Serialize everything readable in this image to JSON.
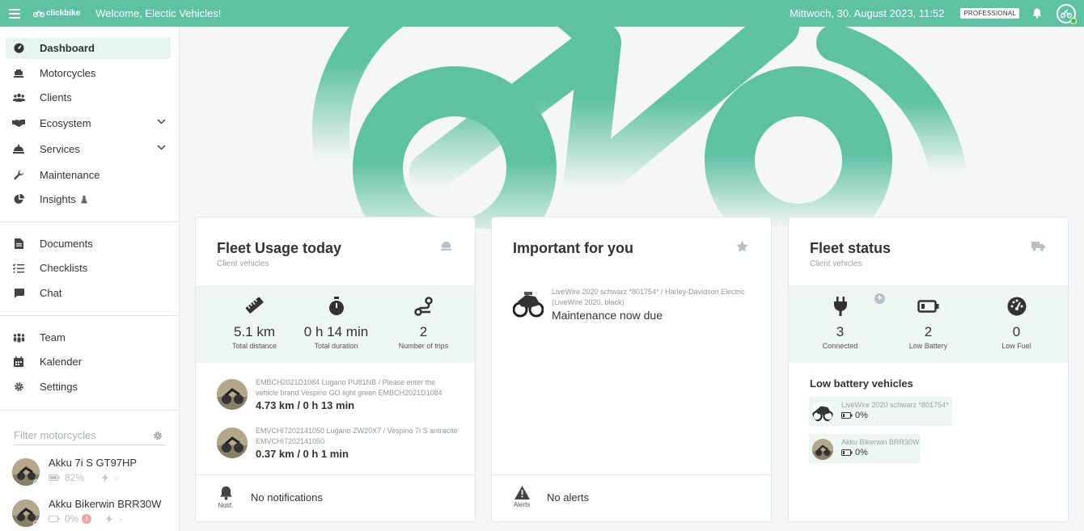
{
  "topbar": {
    "brand": "clickbike",
    "welcome": "Welcome, Electic Vehicles!",
    "datetime": "Mittwoch, 30. August 2023, 11:52",
    "plan": "PROFESSIONAL"
  },
  "sidebar": {
    "groups": [
      [
        {
          "label": "Dashboard",
          "icon": "gauge-icon",
          "active": true
        },
        {
          "label": "Motorcycles",
          "icon": "scooter-icon"
        },
        {
          "label": "Clients",
          "icon": "users-icon"
        },
        {
          "label": "Ecosystem",
          "icon": "handshake-icon",
          "expandable": true
        },
        {
          "label": "Services",
          "icon": "service-bell-icon",
          "expandable": true
        },
        {
          "label": "Maintenance",
          "icon": "wrench-icon"
        },
        {
          "label": "Insights",
          "icon": "pie-chart-icon",
          "beta": true
        }
      ],
      [
        {
          "label": "Documents",
          "icon": "document-icon"
        },
        {
          "label": "Checklists",
          "icon": "checklist-icon"
        },
        {
          "label": "Chat",
          "icon": "chat-icon"
        }
      ],
      [
        {
          "label": "Team",
          "icon": "team-icon"
        },
        {
          "label": "Kalender",
          "icon": "calendar-icon"
        },
        {
          "label": "Settings",
          "icon": "gear-icon"
        }
      ]
    ],
    "filter_placeholder": "Filter motorcycles",
    "motorcycles": [
      {
        "name": "Akku 7i S GT97HP",
        "battery": "82%",
        "charge": "-",
        "status_color": "#3ec43e"
      },
      {
        "name": "Akku Bikerwin BRR30W",
        "battery": "0%",
        "charge": "-",
        "status_color": "#e53935",
        "warning": "!"
      }
    ]
  },
  "colors": {
    "brand": "#5dc1a2",
    "band": "#eef6f2"
  },
  "fleet_usage": {
    "title": "Fleet Usage today",
    "subtitle": "Client vehicles",
    "stats": [
      {
        "value": "5.1 km",
        "label": "Total distance",
        "icon": "ruler-icon"
      },
      {
        "value": "0 h 14 min",
        "label": "Total duration",
        "icon": "stopwatch-icon"
      },
      {
        "value": "2",
        "label": "Number of trips",
        "icon": "route-icon"
      }
    ],
    "trips": [
      {
        "desc": "EMBCH2021D1084 Lugano PU81NB / Please enter the vehicle brand Vespino GO light green EMBCH2021D1084",
        "value": "4.73 km / 0 h 13 min"
      },
      {
        "desc": "EMVCHI7202141050 Lugano ZW20X7 / Vespino 7i S antracite EMVCHI7202141050",
        "value": "0.37 km / 0 h 1 min"
      }
    ],
    "footer_label": "Notif.",
    "footer_text": "No notifications"
  },
  "important": {
    "title": "Important for you",
    "item_desc": "LiveWire 2020 schwarz *801754* / Harley-Davidson Electric (LiveWire 2020, black)",
    "item_title": "Maintenance now due",
    "footer_label": "Alerts",
    "footer_text": "No alerts"
  },
  "fleet_status": {
    "title": "Fleet status",
    "subtitle": "Client vehicles",
    "plus": "+",
    "stats": [
      {
        "value": "3",
        "label": "Connected",
        "icon": "plug-icon"
      },
      {
        "value": "2",
        "label": "Low Battery",
        "icon": "battery-low-icon"
      },
      {
        "value": "0",
        "label": "Low Fuel",
        "icon": "fuel-gauge-icon"
      }
    ],
    "low_battery_title": "Low battery vehicles",
    "low_battery": [
      {
        "name": "LiveWire 2020 schwarz *801754*",
        "pct": "0%"
      },
      {
        "name": "Akku Bikerwin BRR30W",
        "pct": "0%"
      }
    ]
  }
}
